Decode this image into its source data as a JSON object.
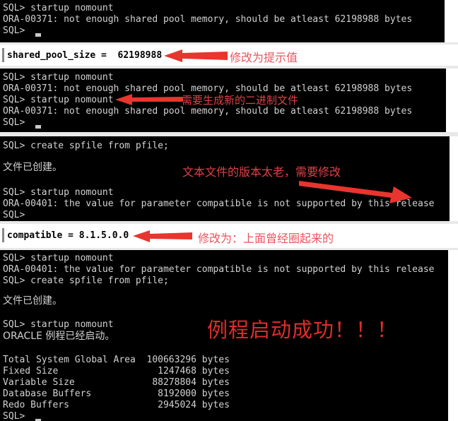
{
  "colors": {
    "terminal_bg": "#000000",
    "terminal_fg": "#d2d2d2",
    "editor_bg": "#ffffff",
    "editor_fg": "#000000",
    "annotation_red": "#e8555f",
    "annotation_red_dark": "#e04048",
    "highlight_red": "#e12b2b",
    "arrow_red": "#e8352e"
  },
  "panels": {
    "terminal_1": {
      "lines": [
        "SQL> startup nomount",
        "ORA-00371: not enough shared pool memory, should be atleast 62198988 bytes",
        "SQL>"
      ]
    },
    "editor_1": {
      "text": "shared_pool_size =  62198988"
    },
    "terminal_2": {
      "lines": [
        "SQL> startup nomount",
        "ORA-00371: not enough shared pool memory, should be atleast 62198988 bytes",
        "SQL> startup nomount",
        "ORA-00371: not enough shared pool memory, should be atleast 62198988 bytes",
        "SQL>"
      ]
    },
    "terminal_3": {
      "lines": [
        "SQL> create spfile from pfile;",
        "",
        "文件已创建。",
        "",
        "SQL> startup nomount",
        "ORA-00401: the value for parameter compatible is not supported by this release",
        "SQL>"
      ]
    },
    "editor_2": {
      "text": "compatible = 8.1.5.0.0"
    },
    "terminal_4": {
      "lines": [
        "SQL> startup nomount",
        "ORA-00401: the value for parameter compatible is not supported by this release",
        "SQL> create spfile from pfile;",
        "",
        "文件已创建。",
        "",
        "SQL> startup nomount",
        "ORACLE 例程已经启动。",
        "",
        "Total System Global Area  100663296 bytes",
        "Fixed Size                  1247468 bytes",
        "Variable Size              88278804 bytes",
        "Database Buffers            8192000 bytes",
        "Redo Buffers                2945024 bytes",
        "SQL>"
      ]
    }
  },
  "annotations": {
    "note_1": "修改为提示值",
    "note_2": "需要生成新的二进制文件",
    "note_3": "文本文件的版本太老，需要修改",
    "note_4": "修改为：上面曾经圈起来的",
    "success": "例程启动成功！！！"
  }
}
